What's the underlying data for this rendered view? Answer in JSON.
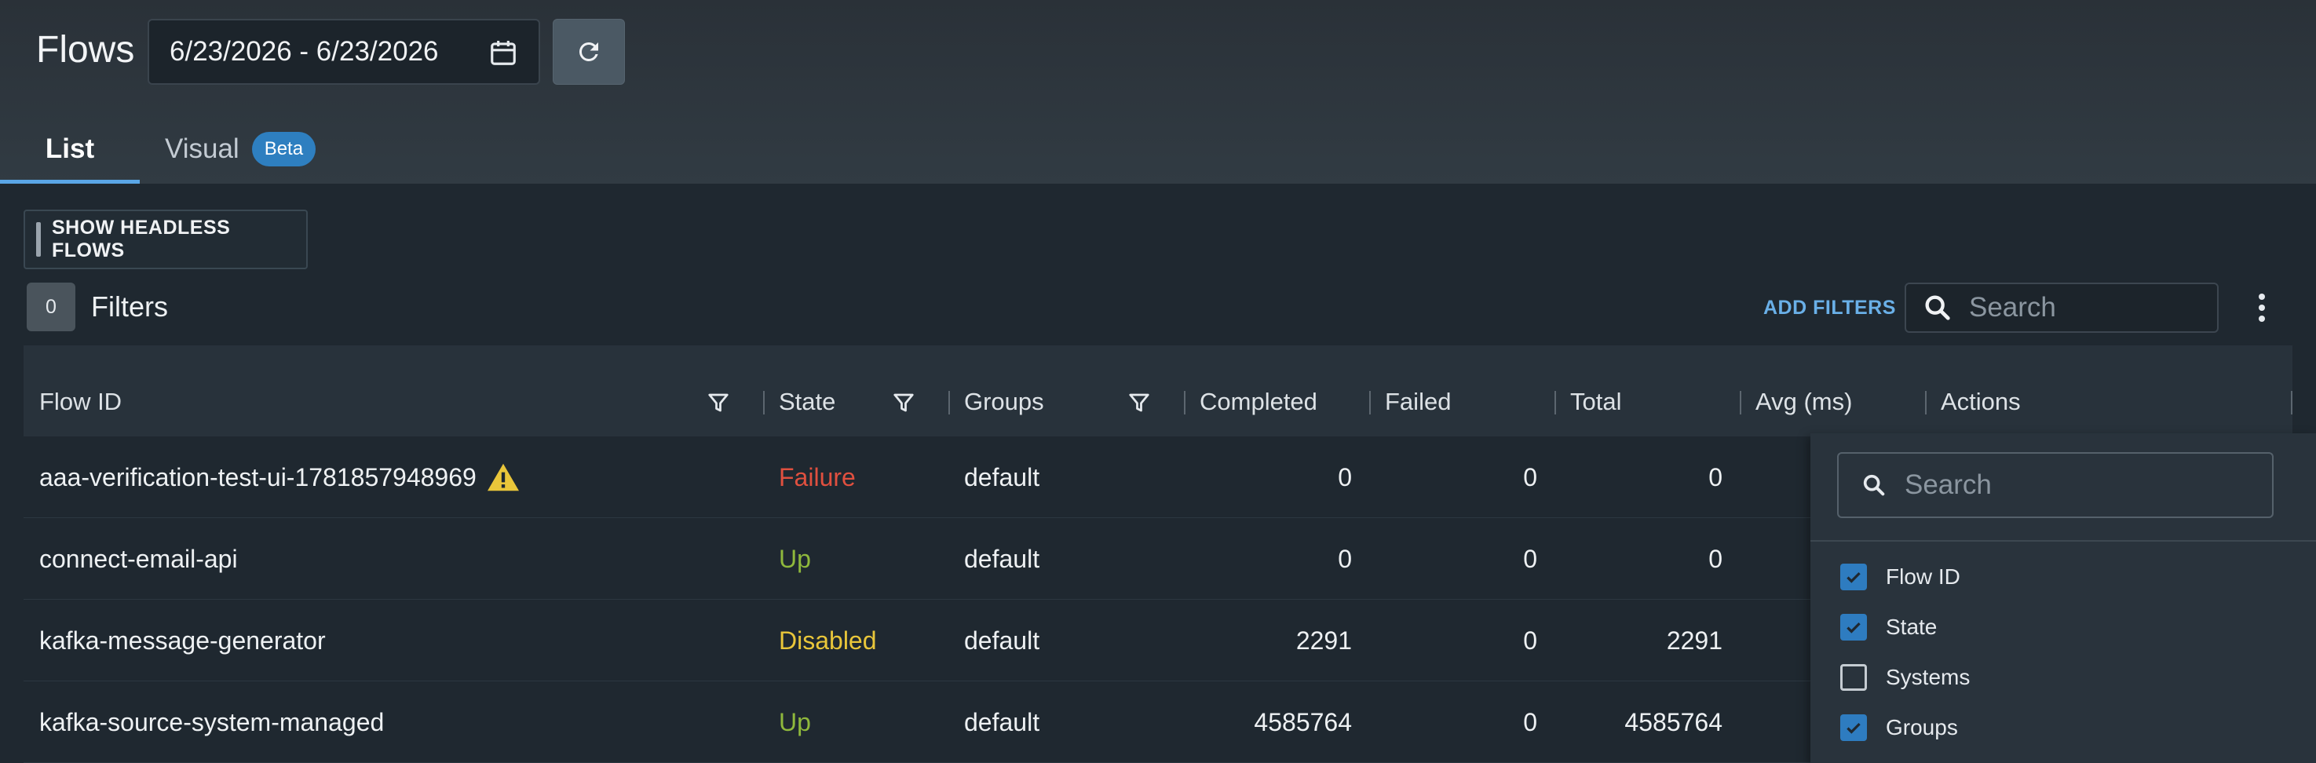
{
  "header": {
    "title": "Flows",
    "date_range": "6/23/2026 - 6/23/2026",
    "icons": {
      "calendar": "calendar-icon",
      "refresh": "refresh-icon"
    }
  },
  "tabs": [
    {
      "label": "List",
      "active": true
    },
    {
      "label": "Visual",
      "badge": "Beta",
      "active": false
    }
  ],
  "toolbar": {
    "headless_label": "SHOW HEADLESS FLOWS",
    "filter_count": "0",
    "filters_label": "Filters",
    "add_filters_label": "ADD FILTERS",
    "search_placeholder": "Search",
    "icons": {
      "search": "search-icon",
      "more": "more-vertical-icon"
    }
  },
  "table": {
    "columns": [
      "Flow ID",
      "State",
      "Groups",
      "Completed",
      "Failed",
      "Total",
      "Avg (ms)",
      "Actions"
    ],
    "rows": [
      {
        "flow_id": "aaa-verification-test-ui-1781857948969",
        "warning": true,
        "state": "Failure",
        "groups": "default",
        "completed": "0",
        "failed": "0",
        "total": "0"
      },
      {
        "flow_id": "connect-email-api",
        "warning": false,
        "state": "Up",
        "groups": "default",
        "completed": "0",
        "failed": "0",
        "total": "0"
      },
      {
        "flow_id": "kafka-message-generator",
        "warning": false,
        "state": "Disabled",
        "groups": "default",
        "completed": "2291",
        "failed": "0",
        "total": "2291"
      },
      {
        "flow_id": "kafka-source-system-managed",
        "warning": false,
        "state": "Up",
        "groups": "default",
        "completed": "4585764",
        "failed": "0",
        "total": "4585764"
      }
    ]
  },
  "column_panel": {
    "search_placeholder": "Search",
    "items": [
      {
        "label": "Flow ID",
        "checked": true
      },
      {
        "label": "State",
        "checked": true
      },
      {
        "label": "Systems",
        "checked": false
      },
      {
        "label": "Groups",
        "checked": true
      }
    ]
  },
  "colors": {
    "accent": "#2e7cc0",
    "failure": "#e0503f",
    "up": "#8fb83c",
    "disabled": "#e9c63a"
  }
}
